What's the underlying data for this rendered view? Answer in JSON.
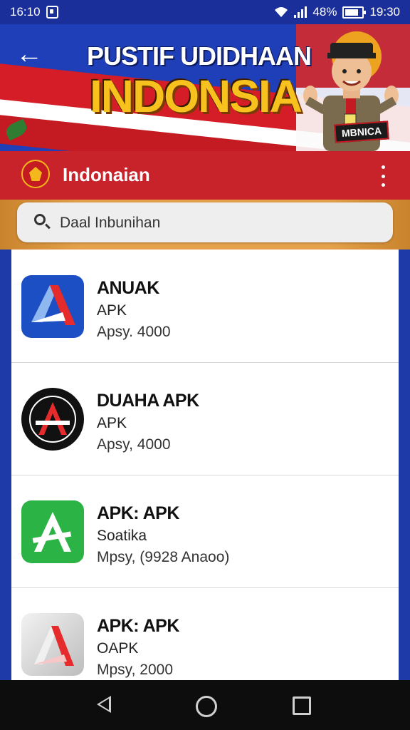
{
  "status_bar": {
    "time_left": "16:10",
    "battery": "48%",
    "time_right": "19:30"
  },
  "banner": {
    "title_line1": "PUSTIF UDIDHAAN",
    "title_line2": "INDONSIA",
    "badge": "MBNICA"
  },
  "header": {
    "title": "Indonaian"
  },
  "search": {
    "placeholder": "Daal Inbunihan"
  },
  "apps": [
    {
      "name": "ANUAK",
      "sub": "APK",
      "meta": "Apsy. 4000",
      "icon": "a-logo-blue-icon",
      "bg": "#1d4fc4"
    },
    {
      "name": "DUAHA APK",
      "sub": "APK",
      "meta": "Apsy, 4000",
      "icon": "a-logo-black-circle-icon",
      "bg": "#111111"
    },
    {
      "name": "APK: APK",
      "sub": "Soatika",
      "meta": "Mpsy, (9928 Anaoo)",
      "icon": "a-logo-green-icon",
      "bg": "#2bb346"
    },
    {
      "name": "APK: APK",
      "sub": "OAPK",
      "meta": "Mpsy, 2000",
      "icon": "a-logo-silver-icon",
      "bg": "#d9d9d9"
    }
  ],
  "colors": {
    "header_red": "#c8232b",
    "banner_blue": "#1f3fb8",
    "accent_gold": "#f8c21e"
  }
}
